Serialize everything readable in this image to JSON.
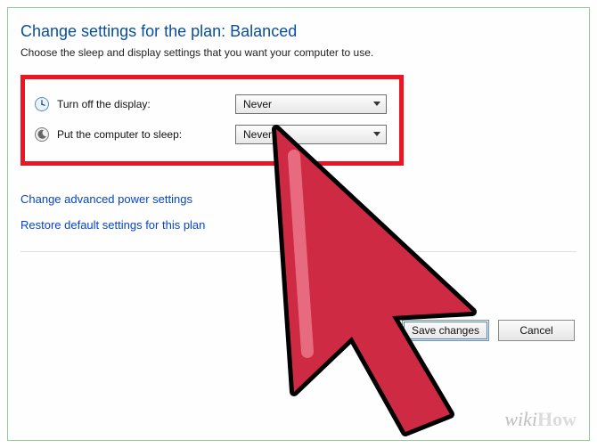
{
  "title": "Change settings for the plan: Balanced",
  "subtitle": "Choose the sleep and display settings that you want your computer to use.",
  "rows": {
    "display": {
      "label": "Turn off the display:",
      "value": "Never"
    },
    "sleep": {
      "label": "Put the computer to sleep:",
      "value": "Never"
    }
  },
  "links": {
    "advanced": "Change advanced power settings",
    "restore": "Restore default settings for this plan"
  },
  "buttons": {
    "save": "Save changes",
    "cancel": "Cancel"
  },
  "watermark": {
    "wiki": "wiki",
    "how": "How"
  }
}
